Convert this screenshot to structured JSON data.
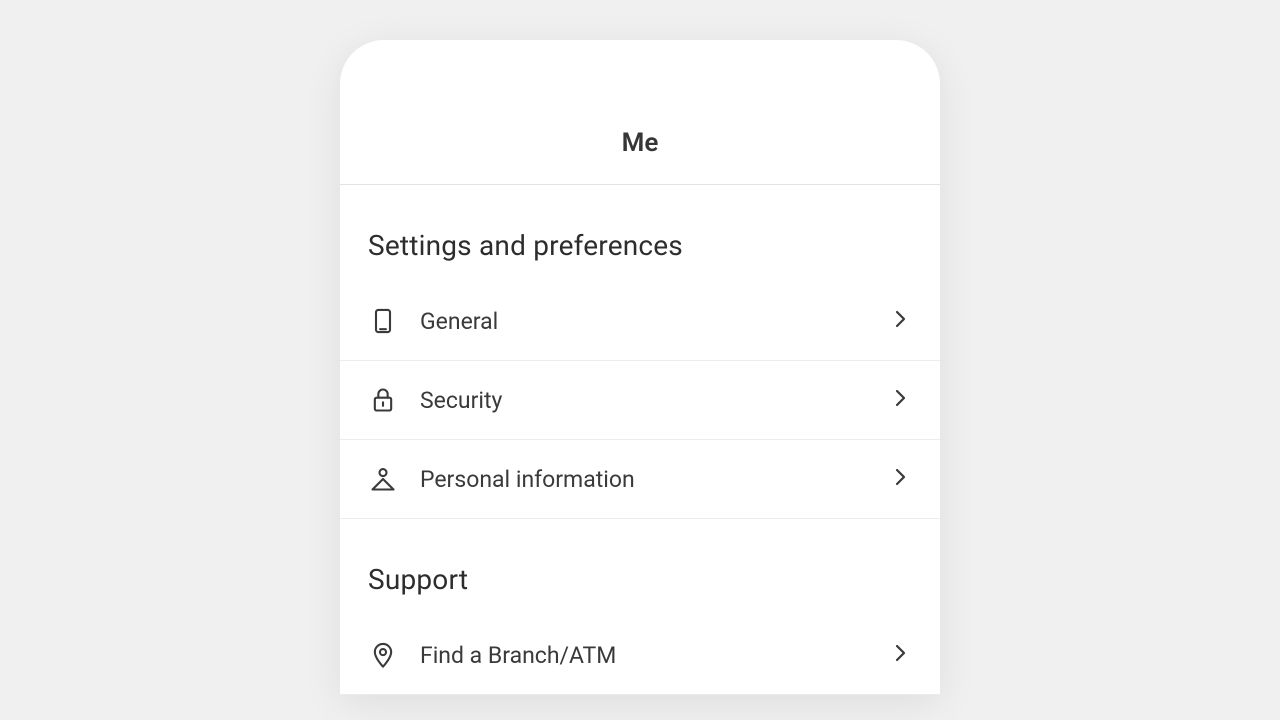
{
  "header": {
    "title": "Me"
  },
  "sections": [
    {
      "title": "Settings and preferences",
      "items": [
        {
          "label": "General",
          "icon": "device"
        },
        {
          "label": "Security",
          "icon": "lock"
        },
        {
          "label": "Personal information",
          "icon": "person"
        }
      ]
    },
    {
      "title": "Support",
      "items": [
        {
          "label": "Find a Branch/ATM",
          "icon": "location"
        }
      ]
    }
  ]
}
